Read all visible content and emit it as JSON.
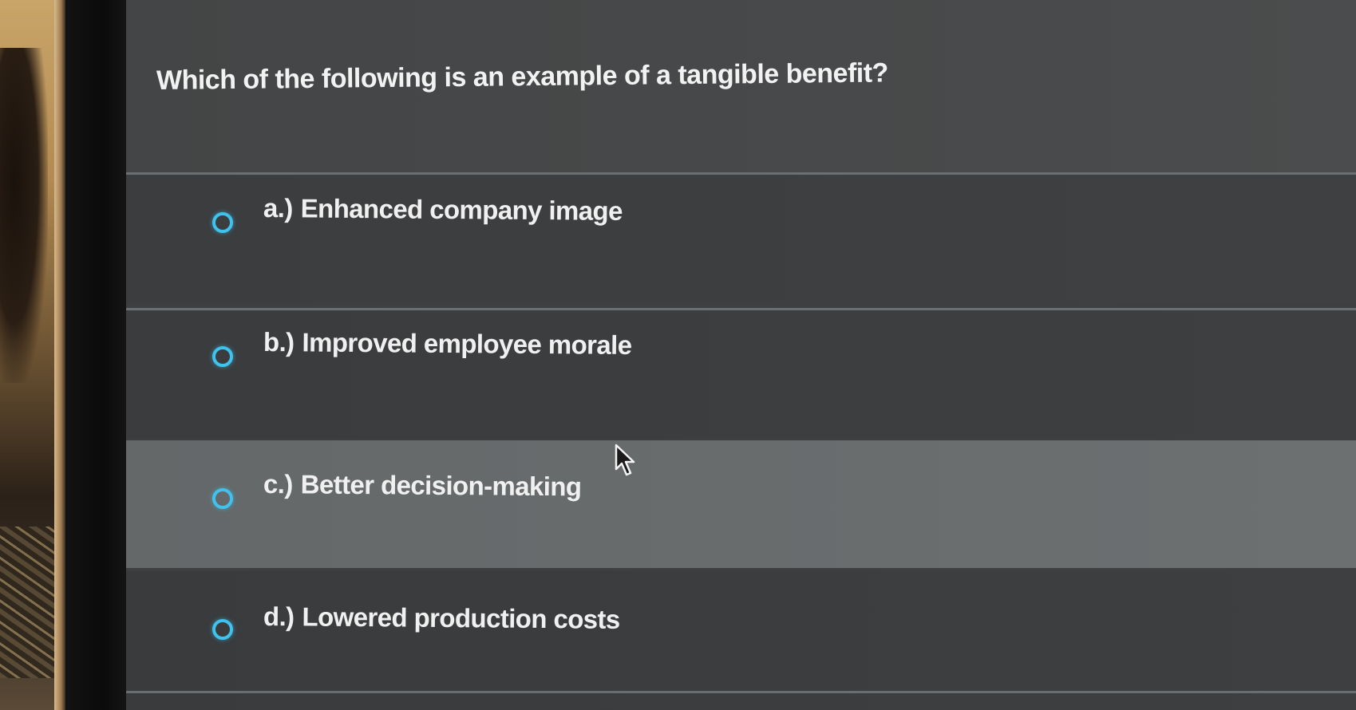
{
  "question": {
    "text": "Which of the following is an example of a tangible benefit?"
  },
  "options": [
    {
      "letter": "a.)",
      "label": "Enhanced company image",
      "selected": false
    },
    {
      "letter": "b.)",
      "label": "Improved employee morale",
      "selected": false
    },
    {
      "letter": "c.)",
      "label": "Better decision-making",
      "selected": false,
      "hovered": true
    },
    {
      "letter": "d.)",
      "label": "Lowered production costs",
      "selected": false
    }
  ],
  "colors": {
    "radio_accent": "#3fc3ee",
    "background": "#3d3f41",
    "hover_row": "#6a6e6f",
    "text": "#f0f0f0"
  },
  "icons": {
    "radio": "radio-button-icon",
    "cursor": "mouse-pointer-icon"
  }
}
